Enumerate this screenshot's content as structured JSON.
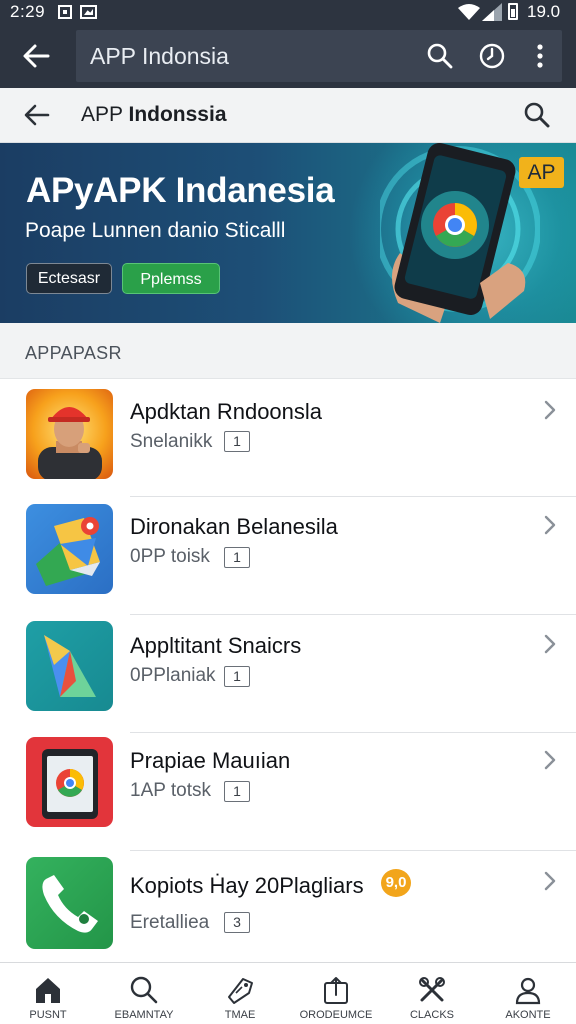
{
  "status_bar": {
    "time": "2:29",
    "right_text": "19.0"
  },
  "app_bar": {
    "title": "APP Indonsia"
  },
  "toolbar": {
    "title_prefix": "APP ",
    "title_bold": "Indonssia"
  },
  "banner": {
    "title": "APyAPK Indanesia",
    "subtitle": "Poape Lunnen danio Sticalll",
    "button_a": "Ectesasr",
    "button_b": "Pplemss",
    "badge": "AP"
  },
  "section": {
    "title": "APPAPASR"
  },
  "apps": [
    {
      "title": "Apdktan Rndoonsla",
      "subtitle": "Snelanikk",
      "count": "1"
    },
    {
      "title": "Dironakan Belanesila",
      "subtitle": "0PP tοisk",
      "count": "1"
    },
    {
      "title": "Appltitant Snaicrs",
      "subtitle": "0PPlaniak",
      "count": "1"
    },
    {
      "title": "Prapiae Mauıian",
      "subtitle": "1AP tοtsk",
      "count": "1"
    },
    {
      "title": "Kopiots Ḣay 20Plagliars",
      "subtitle": "Eretalliea",
      "count": "3",
      "badge": "9,0"
    }
  ],
  "bottom_nav": [
    {
      "label": "PUSNT",
      "icon": "home-icon"
    },
    {
      "label": "EBAMNTAY",
      "icon": "search-icon"
    },
    {
      "label": "TMAE",
      "icon": "tag-icon"
    },
    {
      "label": "ORODEUMCE",
      "icon": "share-icon"
    },
    {
      "label": "CLACKS",
      "icon": "tools-icon"
    },
    {
      "label": "AKONTE",
      "icon": "account-icon"
    }
  ],
  "colors": {
    "app_bar": "#2d3440",
    "accent_green": "#2aa049",
    "badge_orange": "#f1b21b"
  }
}
